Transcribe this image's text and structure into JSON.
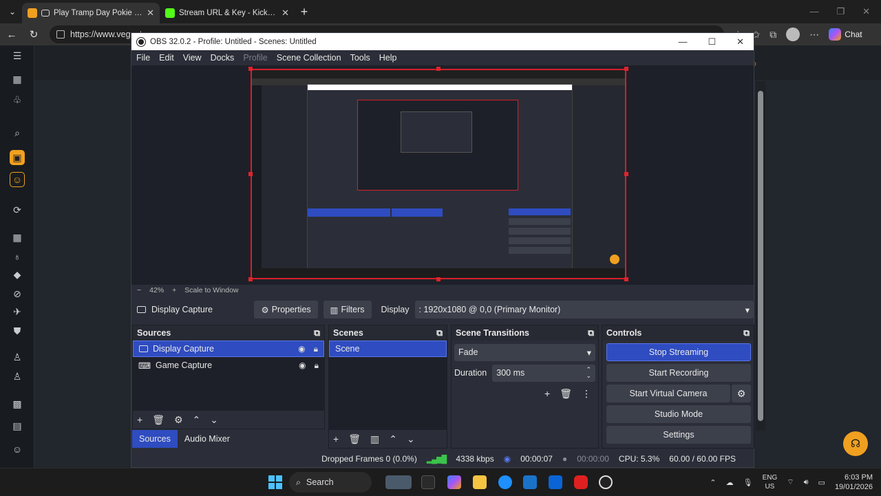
{
  "browser": {
    "tabs": [
      {
        "title": "Play Tramp Day Pokie Online",
        "close": "✕",
        "favicon_color": "#f0a020"
      },
      {
        "title": "Stream URL & Key - Kick Dashboard",
        "close": "✕",
        "favicon_color": "#53fc18"
      }
    ],
    "url": "https://www.vegasta",
    "chat_label": "Chat"
  },
  "obs": {
    "title": "OBS 32.0.2 - Profile: Untitled - Scenes: Untitled",
    "menu": [
      "File",
      "Edit",
      "View",
      "Docks",
      "Profile",
      "Scene Collection",
      "Tools",
      "Help"
    ],
    "zoom": {
      "minus": "−",
      "percent": "42%",
      "plus": "+",
      "mode": "Scale to Window"
    },
    "source_toolbar": {
      "source_name": "Display Capture",
      "properties": "Properties",
      "filters": "Filters",
      "display_label": "Display",
      "display_value": ": 1920x1080 @ 0,0 (Primary Monitor)"
    },
    "sources": {
      "header": "Sources",
      "items": [
        {
          "label": "Display Capture",
          "selected": true
        },
        {
          "label": "Game Capture",
          "selected": false
        }
      ]
    },
    "scenes": {
      "header": "Scenes",
      "items": [
        "Scene"
      ]
    },
    "transitions": {
      "header": "Scene Transitions",
      "type": "Fade",
      "duration_label": "Duration",
      "duration_value": "300 ms"
    },
    "controls": {
      "header": "Controls",
      "stop_streaming": "Stop Streaming",
      "start_recording": "Start Recording",
      "start_virtual_camera": "Start Virtual Camera",
      "studio_mode": "Studio Mode",
      "settings": "Settings"
    },
    "dock_tabs": [
      "Sources",
      "Audio Mixer"
    ],
    "status": {
      "dropped_frames": "Dropped Frames 0 (0.0%)",
      "bitrate": "4338 kbps",
      "stream_time": "00:00:07",
      "rec_time": "00:00:00",
      "cpu": "CPU: 5.3%",
      "fps": "60.00 / 60.00 FPS"
    }
  },
  "taskbar": {
    "search": "Search",
    "lang_top": "ENG",
    "lang_bottom": "US",
    "time": "6:03 PM",
    "date": "19/01/2026"
  }
}
